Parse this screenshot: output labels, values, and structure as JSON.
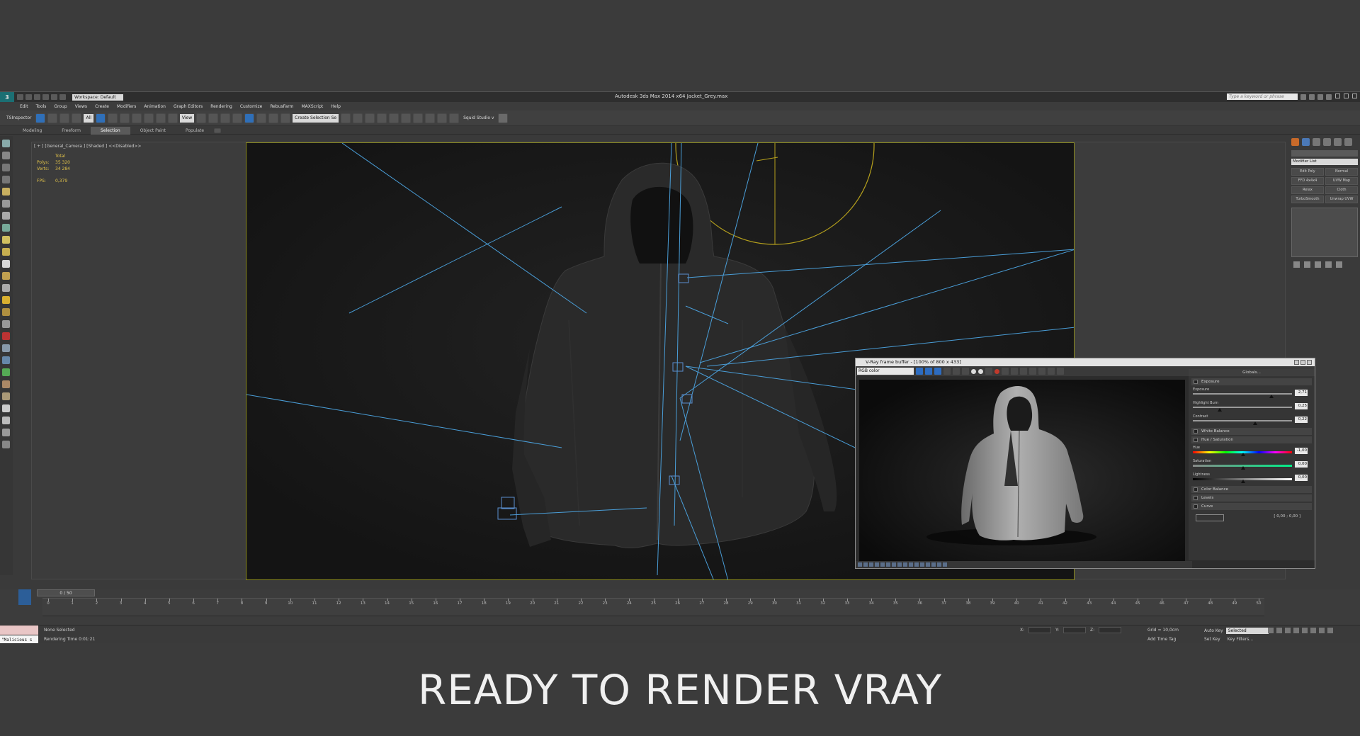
{
  "window": {
    "title": "Autodesk 3ds Max  2014 x64    Jacket_Grey.max",
    "workspace": "Workspace: Default",
    "search_placeholder": "Type a keyword or phrase"
  },
  "menu": [
    "Edit",
    "Tools",
    "Group",
    "Views",
    "Create",
    "Modifiers",
    "Animation",
    "Graph Editors",
    "Rendering",
    "Customize",
    "RebusFarm",
    "MAXScript",
    "Help"
  ],
  "toolbar": {
    "tsinspector": "TSInspector",
    "filter_select": "All",
    "view_select": "View",
    "selection_set": "Create Selection Se",
    "squid_studio": "Squid Studio v"
  },
  "ribbon_tabs": [
    "Modeling",
    "Freeform",
    "Selection",
    "Object Paint",
    "Populate"
  ],
  "ribbon_active": "Selection",
  "viewport": {
    "label": "[ + ] [General_Camera ] [Shaded ]  <<Disabled>>",
    "stats": {
      "total_label": "Total",
      "polys_label": "Polys:",
      "polys_value": "35 320",
      "verts_label": "Verts:",
      "verts_value": "34 284",
      "fps_label": "FPS:",
      "fps_value": "0,379"
    }
  },
  "vfb": {
    "title": "V-Ray frame buffer - [100% of 800 x 433]",
    "channel": "RGB color",
    "globals": "Globals...",
    "sections": {
      "exposure": "Exposure",
      "white_balance": "White Balance",
      "hue_saturation": "Hue / Saturation",
      "color_balance": "Color Balance",
      "levels": "Levels",
      "curve": "Curve"
    },
    "exposure_sliders": [
      {
        "label": "Exposure",
        "value": "2,71"
      },
      {
        "label": "Highlight Burn",
        "value": "0,25"
      },
      {
        "label": "Contrast",
        "value": "0,22"
      }
    ],
    "hue_sliders": [
      {
        "label": "Hue",
        "value": "-1,00"
      },
      {
        "label": "Saturation",
        "value": "0,00"
      },
      {
        "label": "Lightness",
        "value": "0,00"
      }
    ],
    "curve_coord": "[ 0,00 ; 0,00 ]"
  },
  "command_panel": {
    "modifier_list": "Modifier List",
    "buttons": [
      "Edit Poly",
      "Normal",
      "FFD 4x4x4",
      "UVW Map",
      "Relax",
      "Cloth",
      "TurboSmooth",
      "Unwrap UVW"
    ]
  },
  "timeline": {
    "position": "0 / 50",
    "ticks": [
      "0",
      "1",
      "2",
      "3",
      "4",
      "5",
      "6",
      "7",
      "8",
      "9",
      "10",
      "11",
      "12",
      "13",
      "14",
      "15",
      "16",
      "17",
      "18",
      "19",
      "20",
      "21",
      "22",
      "23",
      "24",
      "25",
      "26",
      "27",
      "28",
      "29",
      "30",
      "31",
      "32",
      "33",
      "34",
      "35",
      "36",
      "37",
      "38",
      "39",
      "40",
      "41",
      "42",
      "43",
      "44",
      "45",
      "46",
      "47",
      "48",
      "49",
      "50"
    ]
  },
  "status": {
    "maxscript": "\"Malicious s",
    "selection": "None Selected",
    "rendering_time": "Rendering Time  0:01:21",
    "x_label": "X:",
    "y_label": "Y:",
    "z_label": "Z:",
    "grid": "Grid = 10,0cm",
    "add_time_tag": "Add Time Tag",
    "auto_key": "Auto Key",
    "selected": "Selected",
    "set_key": "Set Key",
    "key_filters": "Key Filters..."
  },
  "caption": "READY TO RENDER VRAY",
  "colors": {
    "accent_blue": "#2f6fb8",
    "safe_frame": "#8a8a1e",
    "stats_yellow": "#e0c24a",
    "light_lines": "#4a9ed8"
  }
}
